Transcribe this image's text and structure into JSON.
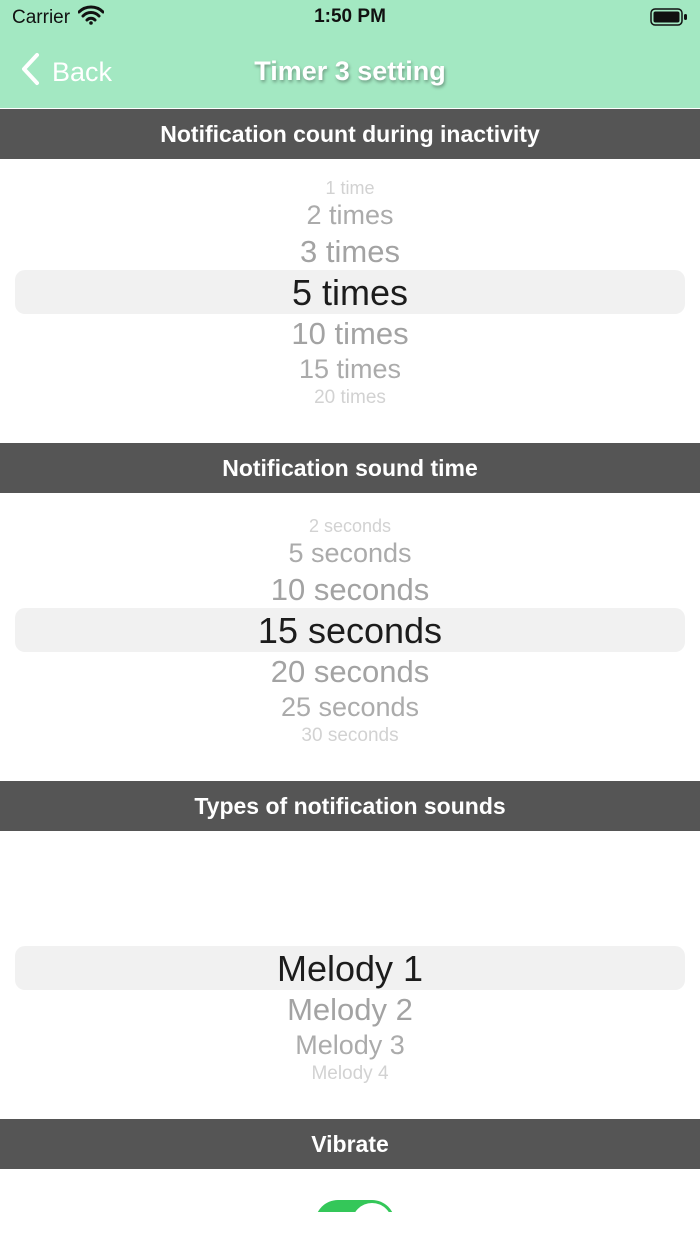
{
  "status_bar": {
    "carrier": "Carrier",
    "time": "1:50 PM"
  },
  "nav": {
    "back_label": "Back",
    "title": "Timer 3 setting",
    "bar_color": "#a3e8c2"
  },
  "sections": {
    "notification_count": {
      "header": "Notification count during inactivity",
      "items": [
        "1 time",
        "2 times",
        "3 times",
        "5 times",
        "10 times",
        "15 times",
        "20 times"
      ],
      "selected": "5 times"
    },
    "sound_time": {
      "header": "Notification sound time",
      "items": [
        "2 seconds",
        "5 seconds",
        "10 seconds",
        "15 seconds",
        "20 seconds",
        "25 seconds",
        "30 seconds"
      ],
      "selected": "15 seconds"
    },
    "sound_type": {
      "header": "Types of notification sounds",
      "items": [
        "Melody 1",
        "Melody 2",
        "Melody 3",
        "Melody 4"
      ],
      "selected": "Melody 1"
    },
    "vibrate": {
      "header": "Vibrate",
      "enabled": true,
      "toggle_color": "#34c759"
    }
  },
  "icons": {
    "back": "chevron-left-icon",
    "wifi": "wifi-icon",
    "battery": "battery-icon"
  }
}
